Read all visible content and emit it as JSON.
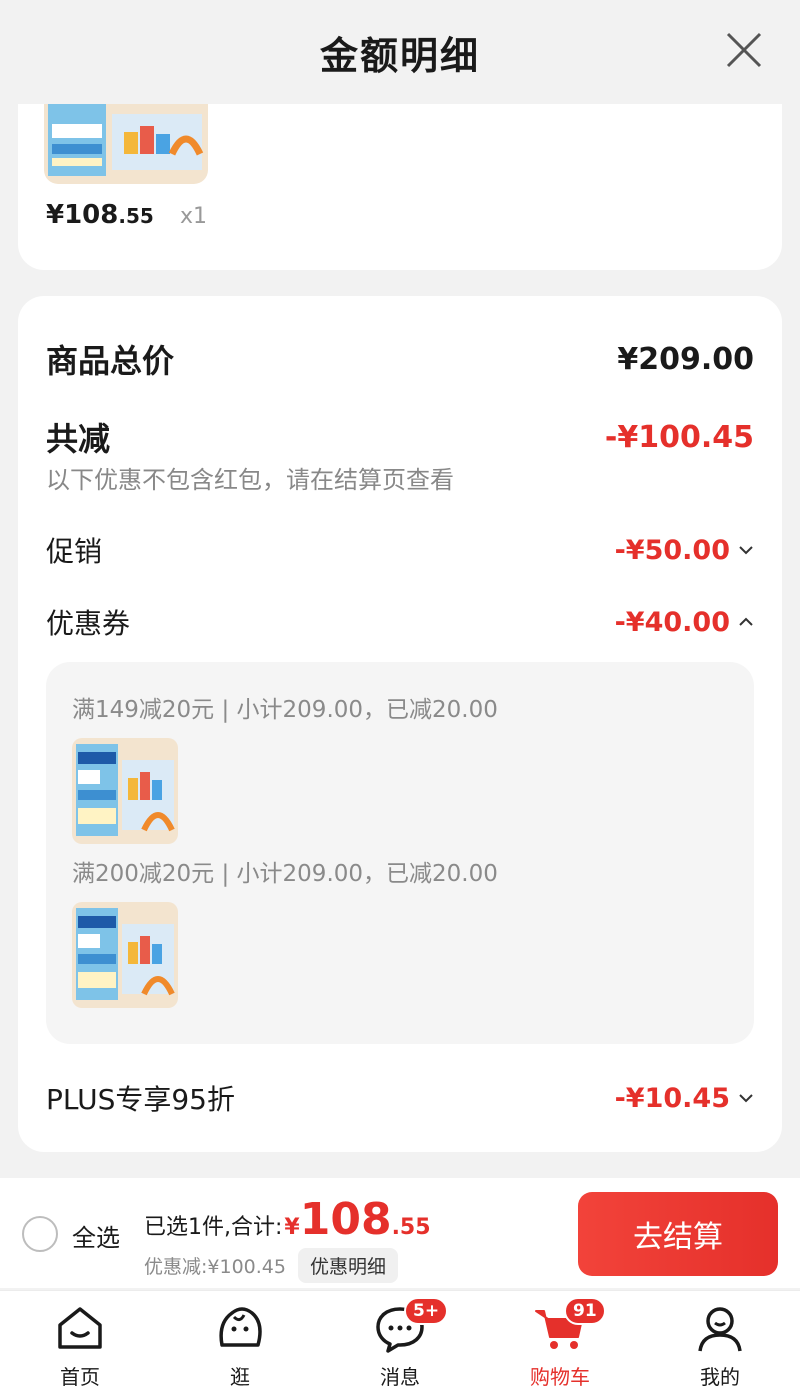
{
  "header": {
    "title": "金额明细"
  },
  "top_item": {
    "price_int": "¥108",
    "price_dec": ".55",
    "qty": "x1"
  },
  "summary": {
    "total_label": "商品总价",
    "total_value": "¥209.00",
    "reduce_label": "共减",
    "reduce_value": "-¥100.45",
    "note": "以下优惠不包含红包，请在结算页查看",
    "promo_label": "促销",
    "promo_value": "-¥50.00",
    "coupon_label": "优惠券",
    "coupon_value": "-¥40.00",
    "coupons": [
      {
        "text": "满149减20元 | 小计209.00，已减20.00"
      },
      {
        "text": "满200减20元 | 小计209.00，已减20.00"
      }
    ],
    "plus_label": "PLUS专享95折",
    "plus_value": "-¥10.45"
  },
  "checkout": {
    "select_all": "全选",
    "selected_text": "已选1件,合计:",
    "total_yen": "¥",
    "total_int": "108",
    "total_dec": ".55",
    "discount_text": "优惠减:¥100.45",
    "detail_label": "优惠明细",
    "button_label": "去结算"
  },
  "tabs": [
    {
      "label": "首页",
      "icon": "home-icon"
    },
    {
      "label": "逛",
      "icon": "browse-icon"
    },
    {
      "label": "消息",
      "icon": "message-icon",
      "badge": "5+"
    },
    {
      "label": "购物车",
      "icon": "cart-icon",
      "badge": "91",
      "active": true
    },
    {
      "label": "我的",
      "icon": "profile-icon"
    }
  ],
  "colors": {
    "accent": "#e5302b",
    "background": "#f2f2f2"
  }
}
